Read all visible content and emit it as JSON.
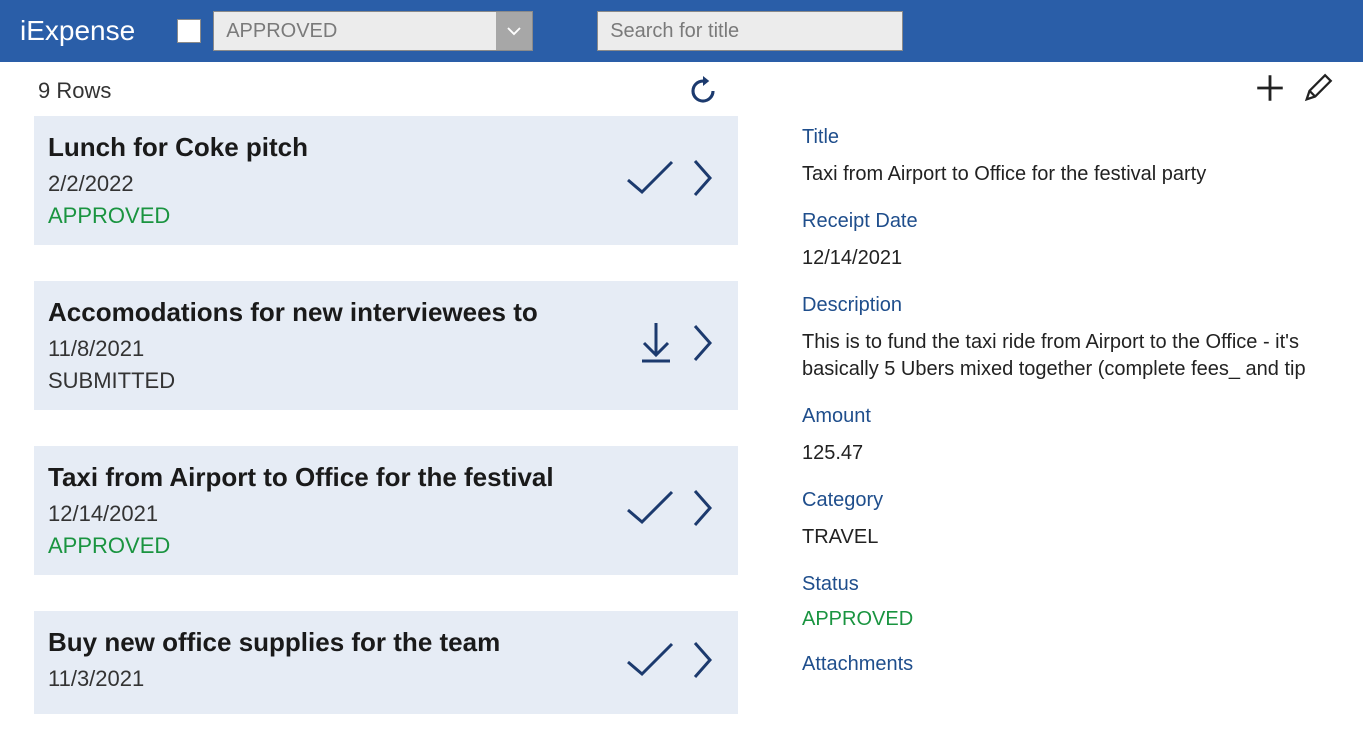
{
  "header": {
    "app_title": "iExpense",
    "filter_selected": "APPROVED",
    "search_placeholder": "Search for title"
  },
  "list": {
    "row_count_label": "9 Rows",
    "items": [
      {
        "title": "Lunch for Coke pitch",
        "date": "2/2/2022",
        "status": "APPROVED",
        "status_class": "approved",
        "action_icon": "check"
      },
      {
        "title": "Accomodations for new interviewees to",
        "date": "11/8/2021",
        "status": "SUBMITTED",
        "status_class": "submitted",
        "action_icon": "download"
      },
      {
        "title": "Taxi from Airport to Office for the festival",
        "date": "12/14/2021",
        "status": "APPROVED",
        "status_class": "approved",
        "action_icon": "check"
      },
      {
        "title": "Buy new office supplies for the team",
        "date": "11/3/2021",
        "status": "",
        "status_class": "approved",
        "action_icon": "check"
      }
    ]
  },
  "detail": {
    "labels": {
      "title": "Title",
      "receipt_date": "Receipt Date",
      "description": "Description",
      "amount": "Amount",
      "category": "Category",
      "status": "Status",
      "attachments": "Attachments"
    },
    "values": {
      "title": "Taxi from Airport to Office for the festival party",
      "receipt_date": "12/14/2021",
      "description": "This is to fund the taxi ride from Airport to the Office - it's basically 5 Ubers mixed together (complete fees_ and tip",
      "amount": "125.47",
      "category": "TRAVEL",
      "status": "APPROVED"
    }
  }
}
